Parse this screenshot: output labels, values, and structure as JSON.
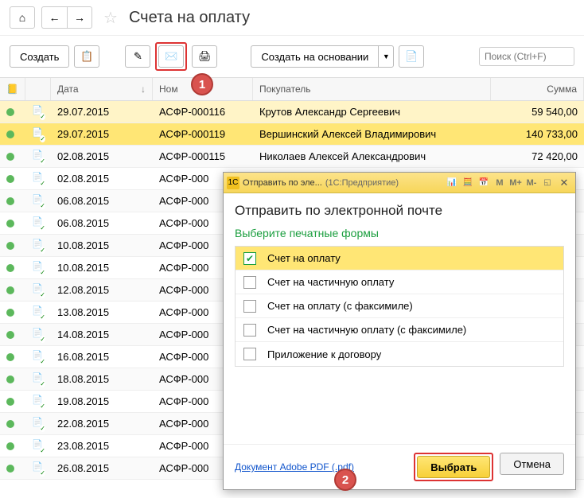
{
  "header": {
    "title": "Счета на оплату"
  },
  "toolbar": {
    "create": "Создать",
    "createBasedOn": "Создать на основании",
    "searchPlaceholder": "Поиск (Ctrl+F)"
  },
  "columns": {
    "date": "Дата",
    "number": "Ном",
    "buyer": "Покупатель",
    "sum": "Сумма"
  },
  "rows": [
    {
      "date": "29.07.2015",
      "num": "АСФР-000116",
      "buyer": "Крутов Александр Сергеевич",
      "sum": "59 540,00",
      "hl": 1
    },
    {
      "date": "29.07.2015",
      "num": "АСФР-000119",
      "buyer": "Вершинский Алексей Владимирович",
      "sum": "140 733,00",
      "hl": 2
    },
    {
      "date": "02.08.2015",
      "num": "АСФР-000115",
      "buyer": "Николаев Алексей Александрович",
      "sum": "72 420,00"
    },
    {
      "date": "02.08.2015",
      "num": "АСФР-000",
      "buyer": "",
      "sum": ""
    },
    {
      "date": "06.08.2015",
      "num": "АСФР-000",
      "buyer": "",
      "sum": ""
    },
    {
      "date": "06.08.2015",
      "num": "АСФР-000",
      "buyer": "",
      "sum": ""
    },
    {
      "date": "10.08.2015",
      "num": "АСФР-000",
      "buyer": "",
      "sum": ""
    },
    {
      "date": "10.08.2015",
      "num": "АСФР-000",
      "buyer": "",
      "sum": ""
    },
    {
      "date": "12.08.2015",
      "num": "АСФР-000",
      "buyer": "",
      "sum": ""
    },
    {
      "date": "13.08.2015",
      "num": "АСФР-000",
      "buyer": "",
      "sum": ""
    },
    {
      "date": "14.08.2015",
      "num": "АСФР-000",
      "buyer": "",
      "sum": ""
    },
    {
      "date": "16.08.2015",
      "num": "АСФР-000",
      "buyer": "",
      "sum": ""
    },
    {
      "date": "18.08.2015",
      "num": "АСФР-000",
      "buyer": "",
      "sum": ""
    },
    {
      "date": "19.08.2015",
      "num": "АСФР-000",
      "buyer": "",
      "sum": ""
    },
    {
      "date": "22.08.2015",
      "num": "АСФР-000",
      "buyer": "",
      "sum": ""
    },
    {
      "date": "23.08.2015",
      "num": "АСФР-000",
      "buyer": "",
      "sum": ""
    },
    {
      "date": "26.08.2015",
      "num": "АСФР-000",
      "buyer": "",
      "sum": ""
    }
  ],
  "dialog": {
    "titleShort": "Отправить по эле...",
    "titleApp": "(1С:Предприятие)",
    "heading": "Отправить по электронной почте",
    "subheading": "Выберите печатные формы",
    "forms": [
      {
        "label": "Счет на оплату",
        "checked": true
      },
      {
        "label": "Счет на частичную оплату",
        "checked": false
      },
      {
        "label": "Счет на оплату (с факсимиле)",
        "checked": false
      },
      {
        "label": "Счет на частичную оплату (с факсимиле)",
        "checked": false
      },
      {
        "label": "Приложение к договору",
        "checked": false
      }
    ],
    "link": "Документ Adobe PDF (.pdf)",
    "select": "Выбрать",
    "cancel": "Отмена",
    "mButtons": [
      "M",
      "M+",
      "M-"
    ]
  },
  "callouts": {
    "one": "1",
    "two": "2"
  }
}
